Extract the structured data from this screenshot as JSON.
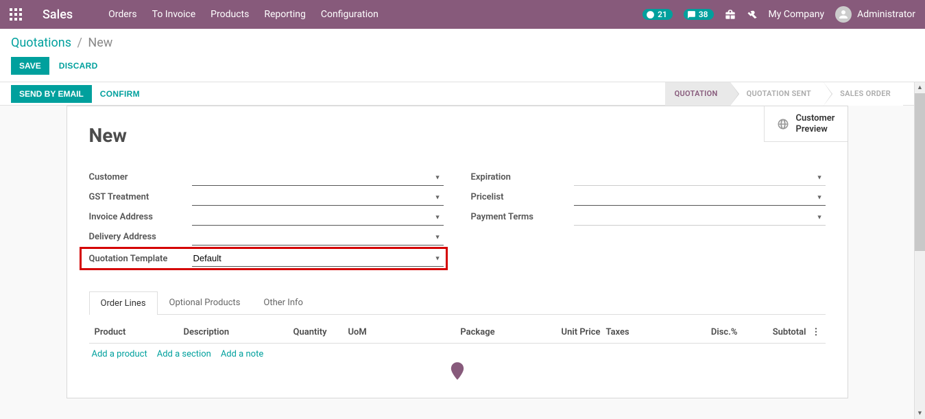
{
  "topbar": {
    "brand": "Sales",
    "nav": [
      "Orders",
      "To Invoice",
      "Products",
      "Reporting",
      "Configuration"
    ],
    "badge_clock": "21",
    "badge_chat": "38",
    "company": "My Company",
    "user": "Administrator"
  },
  "breadcrumb": {
    "root": "Quotations",
    "current": "New"
  },
  "buttons": {
    "save": "SAVE",
    "discard": "DISCARD",
    "send_email": "SEND BY EMAIL",
    "confirm": "CONFIRM"
  },
  "status_steps": [
    "QUOTATION",
    "QUOTATION SENT",
    "SALES ORDER"
  ],
  "sheet": {
    "customer_preview": "Customer Preview",
    "title": "New",
    "labels_left": {
      "customer": "Customer",
      "gst": "GST Treatment",
      "invoice_addr": "Invoice Address",
      "delivery_addr": "Delivery Address",
      "quotation_tpl": "Quotation Template"
    },
    "labels_right": {
      "expiration": "Expiration",
      "pricelist": "Pricelist",
      "payment_terms": "Payment Terms"
    },
    "values": {
      "quotation_tpl": "Default"
    }
  },
  "tabs": [
    "Order Lines",
    "Optional Products",
    "Other Info"
  ],
  "table": {
    "headers": {
      "product": "Product",
      "desc": "Description",
      "qty": "Quantity",
      "uom": "UoM",
      "pkg": "Package",
      "price": "Unit Price",
      "taxes": "Taxes",
      "disc": "Disc.%",
      "sub": "Subtotal"
    },
    "add_product": "Add a product",
    "add_section": "Add a section",
    "add_note": "Add a note"
  }
}
